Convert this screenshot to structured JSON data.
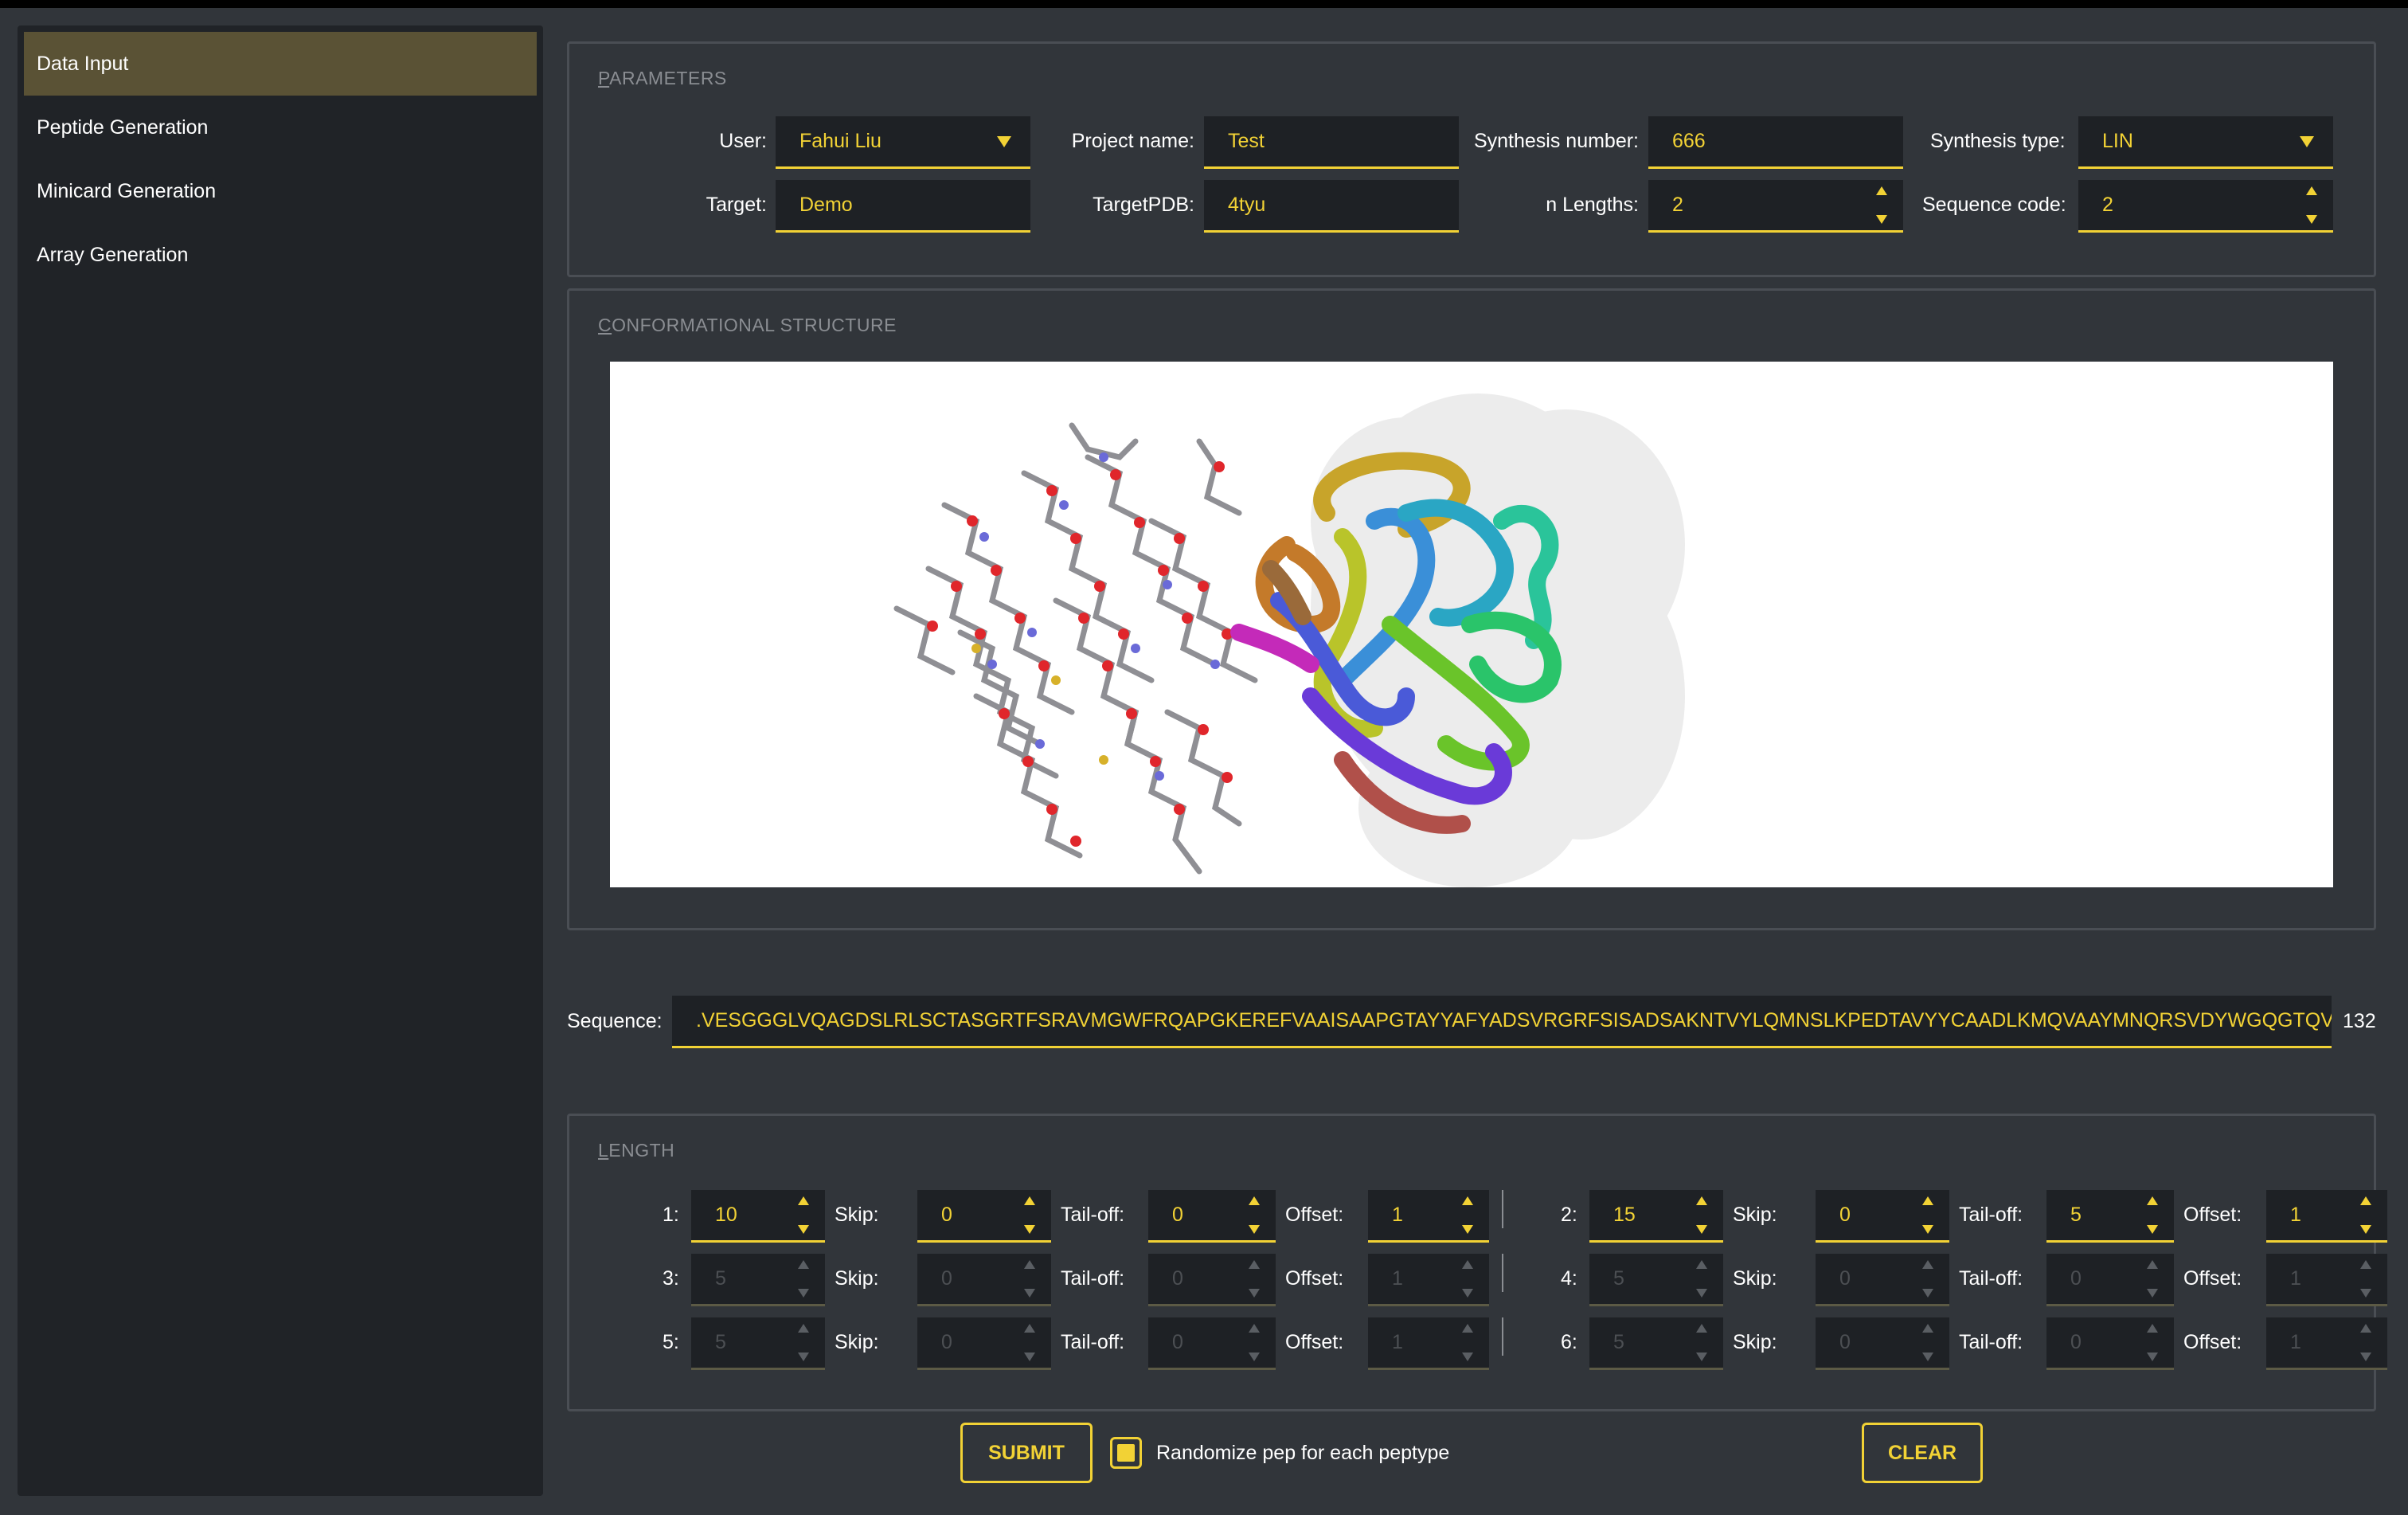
{
  "sidebar": {
    "items": [
      {
        "label": "Data Input",
        "active": true
      },
      {
        "label": "Peptide Generation",
        "active": false
      },
      {
        "label": "Minicard Generation",
        "active": false
      },
      {
        "label": "Array Generation",
        "active": false
      }
    ]
  },
  "parameters": {
    "title_first": "P",
    "title_rest": "ARAMETERS",
    "user_label": "User:",
    "user_value": "Fahui Liu",
    "project_label": "Project name:",
    "project_value": "Test",
    "synthesis_number_label": "Synthesis number:",
    "synthesis_number_value": "666",
    "synthesis_type_label": "Synthesis type:",
    "synthesis_type_value": "LIN",
    "target_label": "Target:",
    "target_value": "Demo",
    "targetpdb_label": "TargetPDB:",
    "targetpdb_value": "4tyu",
    "n_lengths_label": "n Lengths:",
    "n_lengths_value": "2",
    "sequence_code_label": "Sequence code:",
    "sequence_code_value": "2"
  },
  "structure": {
    "title_first": "C",
    "title_rest": "ONFORMATIONAL STRUCTURE"
  },
  "sequence": {
    "label": "Sequence:",
    "value": ".VESGGGLVQAGDSLRLSCTASGRTFSRAVMGWFRQAPGKEREFVAAISAAPGTAYYAFYADSVRGRFSISADSAKNTVYLQMNSLKPEDTAVYYCAADLKMQVAAYMNQRSVDYWGQGTQVTVSS",
    "count": "132"
  },
  "length": {
    "title_first": "L",
    "title_rest": "ENGTH",
    "skip_label": "Skip:",
    "tailoff_label": "Tail-off:",
    "offset_label": "Offset:",
    "rows": [
      {
        "id_label": "1:",
        "length": "10",
        "skip": "0",
        "tailoff": "0",
        "offset": "1",
        "enabled": true
      },
      {
        "id_label": "2:",
        "length": "15",
        "skip": "0",
        "tailoff": "5",
        "offset": "1",
        "enabled": true
      },
      {
        "id_label": "3:",
        "length": "5",
        "skip": "0",
        "tailoff": "0",
        "offset": "1",
        "enabled": false
      },
      {
        "id_label": "4:",
        "length": "5",
        "skip": "0",
        "tailoff": "0",
        "offset": "1",
        "enabled": false
      },
      {
        "id_label": "5:",
        "length": "5",
        "skip": "0",
        "tailoff": "0",
        "offset": "1",
        "enabled": false
      },
      {
        "id_label": "6:",
        "length": "5",
        "skip": "0",
        "tailoff": "0",
        "offset": "1",
        "enabled": false
      }
    ]
  },
  "actions": {
    "submit_label": "SUBMIT",
    "randomize_label": "Randomize pep for each peptype",
    "randomize_checked": true,
    "clear_label": "CLEAR"
  },
  "colors": {
    "accent": "#f2d235",
    "background": "#31353a",
    "sidebar": "#202327",
    "sidebar_active": "#5a5235",
    "field_bg": "#1e2125"
  }
}
